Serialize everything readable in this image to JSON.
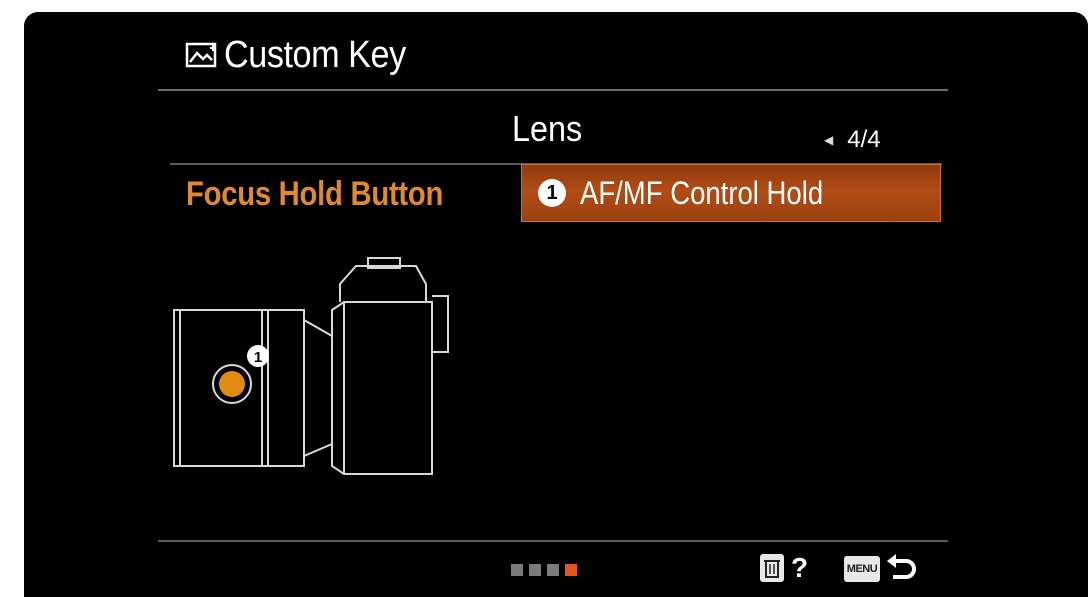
{
  "header": {
    "title": "Custom Key"
  },
  "page": {
    "title": "Lens",
    "pager": "4/4"
  },
  "setting": {
    "label": "Focus Hold Button",
    "badge": "1",
    "value": "AF/MF Control Hold"
  },
  "illustration": {
    "callout": "1"
  },
  "page_dots": {
    "total": 4,
    "active_index": 3
  },
  "footer": {
    "help_label": "?",
    "menu_label": "MENU"
  },
  "colors": {
    "accent": "#e2892e",
    "selection": "#b24c14",
    "active_dot": "#e6551b",
    "button_dot": "#e08a12"
  },
  "icons": [
    "playback-custom-icon",
    "left-arrow-icon",
    "trash-icon",
    "menu-icon",
    "back-icon"
  ]
}
